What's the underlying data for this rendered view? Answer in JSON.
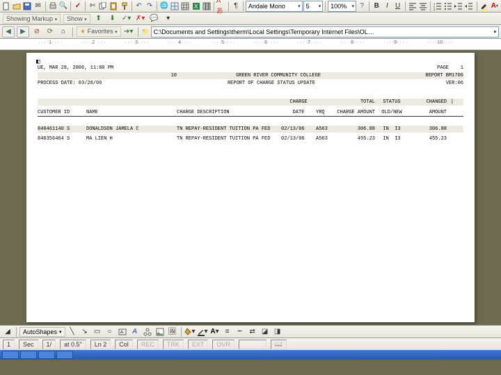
{
  "fontDropdown": "Andale Mono",
  "sizeDropdown": "5",
  "zoomDropdown": "100%",
  "markup": {
    "label": "Showing Markup",
    "show": "Show"
  },
  "favorites": "Favorites",
  "address": "C:\\Documents and Settings\\therm\\Local Settings\\Temporary Internet Files\\OL…",
  "ruler": [
    "1",
    "2",
    "3",
    "4",
    "5",
    "6",
    "7",
    "8",
    "9",
    "10"
  ],
  "report": {
    "corner": "◧",
    "dateLine": "UE, MAR 28, 2006, 11:00 PM",
    "page": "PAGE",
    "pageNo": "1",
    "proc": "PROCESS DATE: 03/28/06",
    "id": "10",
    "college": "GREEN RIVER COMMUNITY COLLEGE",
    "rcode": "REPORT BM1706",
    "title": "REPORT OF CHARGE STATUS UPDATE",
    "ver": "VER:06",
    "h": {
      "cid": "CUSTOMER ID",
      "name": "NAME",
      "desc": "CHARGE DESCRIPTION",
      "cdate": "CHARGE",
      "cdate2": "DATE",
      "yrq": "YRQ",
      "camt": "TOTAL",
      "camt2": "CHARGE AMOUNT",
      "st": "STATUS",
      "st2": "OLD/NEW",
      "chg": "CHANGED",
      "chg2": "AMOUNT"
    },
    "rows": [
      {
        "id": "840461140 S",
        "name": "DONALDSON JAMELA C",
        "desc": "TN REPAY-RESIDENT TUITION PA FED",
        "date": "02/13/06",
        "yrq": "A563",
        "amt": "306.88",
        "st": "IN  I3",
        "chg": "306.88"
      },
      {
        "id": "840356464 S",
        "name": "MA LIEN H",
        "desc": "TN REPAY-RESIDENT TUITION PA FED",
        "date": "02/13/06",
        "yrq": "A563",
        "amt": "455.23",
        "st": "IN  I3",
        "chg": "455.23"
      }
    ]
  },
  "draw": {
    "autoshapes": "AutoShapes"
  },
  "status": {
    "page": "1",
    "sec": "Sec",
    "secv": "1/",
    "at": "at 0.5\"",
    "ln": "Ln 2",
    "col": "Col",
    "rec": "REC",
    "trk": "TRK",
    "ext": "EXT",
    "ovr": "OVR"
  }
}
